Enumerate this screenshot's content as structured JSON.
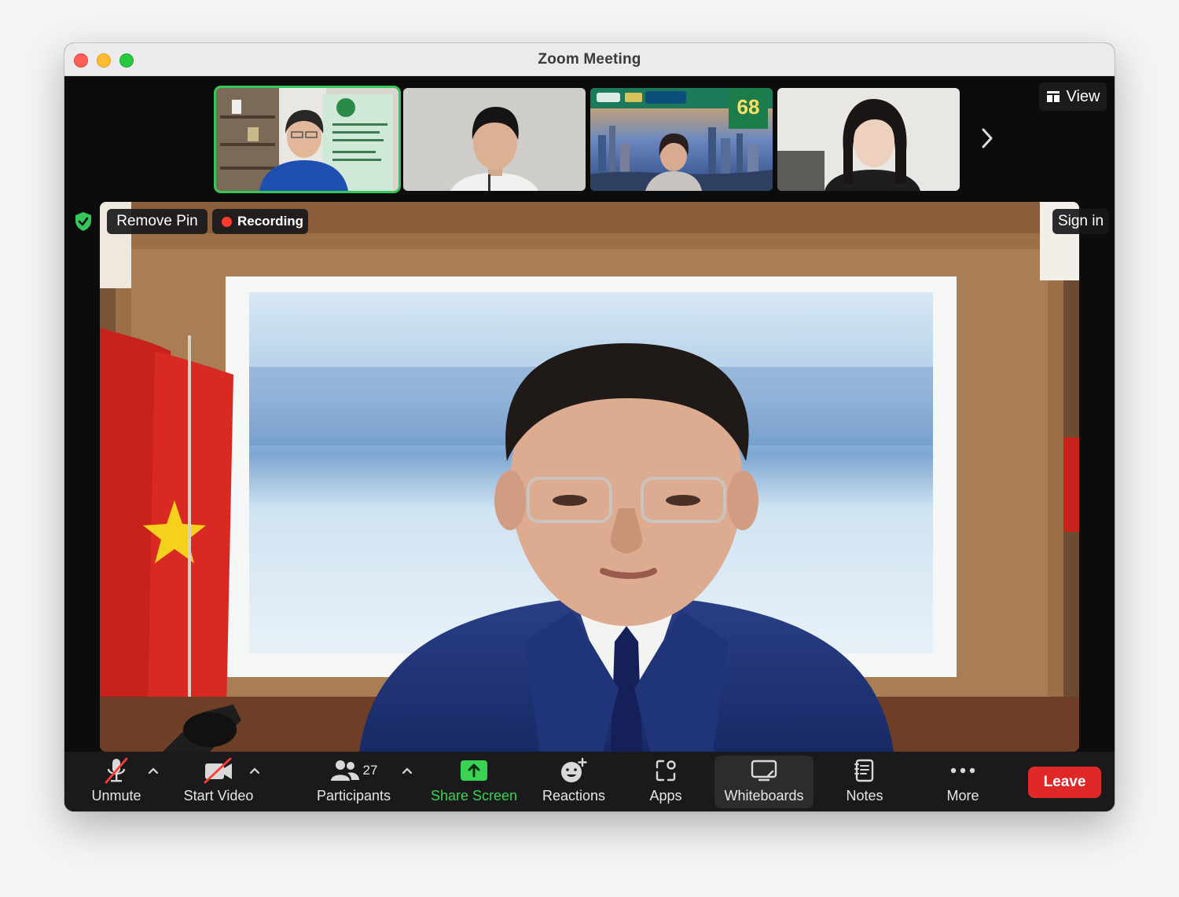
{
  "window": {
    "title": "Zoom Meeting"
  },
  "top_bar": {
    "view_label": "View"
  },
  "thumbnails": [
    {
      "name": "participant-1",
      "active": true
    },
    {
      "name": "participant-2",
      "active": false
    },
    {
      "name": "participant-3",
      "active": false,
      "bg_banner": "68"
    },
    {
      "name": "participant-4",
      "active": false
    }
  ],
  "overlays": {
    "remove_pin": "Remove Pin",
    "recording": "Recording",
    "sign_in": "Sign in"
  },
  "toolbar": {
    "unmute": "Unmute",
    "start_video": "Start Video",
    "participants": "Participants",
    "participant_count": "27",
    "share_screen": "Share Screen",
    "reactions": "Reactions",
    "apps": "Apps",
    "whiteboards": "Whiteboards",
    "notes": "Notes",
    "more": "More",
    "leave": "Leave"
  },
  "colors": {
    "accent_green": "#35c759",
    "share_green": "#39d353",
    "leave_red": "#e02828",
    "recording_red": "#ff3b30"
  }
}
